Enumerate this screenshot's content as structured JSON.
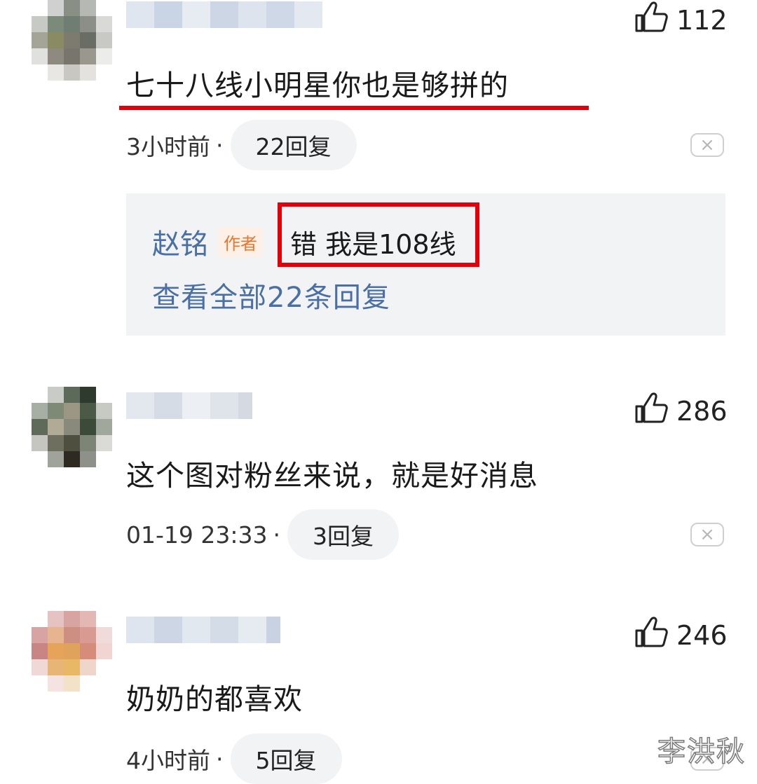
{
  "comments": [
    {
      "likes": "112",
      "text": "七十八线小明星你也是够拼的",
      "time": "3小时前",
      "dot": "·",
      "replies": "22回复",
      "reply_preview": {
        "author": "赵铭",
        "badge": "作者",
        "text": "错 我是108线",
        "view_all": "查看全部22条回复"
      }
    },
    {
      "likes": "286",
      "text": "这个图对粉丝来说，就是好消息",
      "time": "01-19 23:33",
      "dot": "·",
      "replies": "3回复"
    },
    {
      "likes": "246",
      "text": "奶奶的都喜欢",
      "time": "4小时前",
      "dot": "·",
      "replies": "5回复"
    }
  ],
  "icons": {
    "like": "thumbs-up-icon",
    "close": "close-icon",
    "close_glyph": "×"
  },
  "annotation_color": "#e3000b",
  "watermark": "李洪秋"
}
